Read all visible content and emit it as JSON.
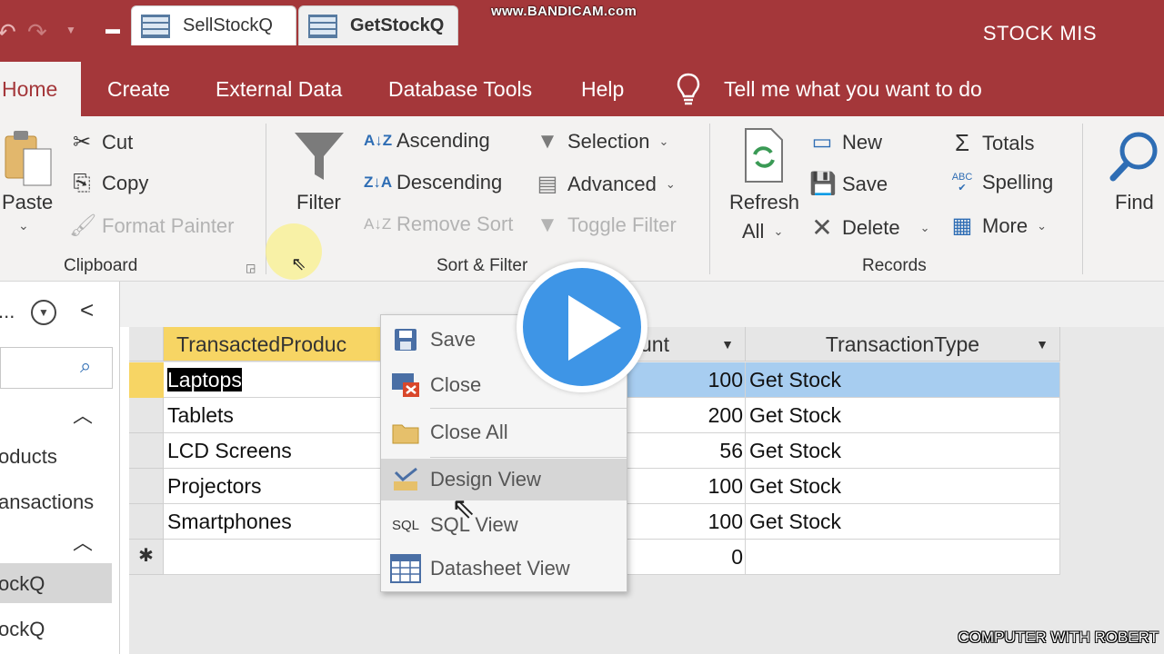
{
  "watermark": "www.BANDICAM.com",
  "app_title": "STOCK MIS",
  "tabs": [
    "Home",
    "Create",
    "External Data",
    "Database Tools",
    "Help"
  ],
  "tell_me": "Tell me what you want to do",
  "clipboard": {
    "paste": "Paste",
    "cut": "Cut",
    "copy": "Copy",
    "format_painter": "Format Painter",
    "label": "Clipboard"
  },
  "sort_filter": {
    "filter": "Filter",
    "ascending": "Ascending",
    "descending": "Descending",
    "remove_sort": "Remove Sort",
    "selection": "Selection",
    "advanced": "Advanced",
    "toggle_filter": "Toggle Filter",
    "label": "Sort & Filter"
  },
  "records": {
    "refresh": "Refresh",
    "refresh_all": "All",
    "new": "New",
    "save": "Save",
    "delete": "Delete",
    "totals": "Totals",
    "spelling": "Spelling",
    "more": "More",
    "label": "Records"
  },
  "find": {
    "label": "Find"
  },
  "nav": {
    "header": "...",
    "items": [
      "oducts",
      "ansactions",
      "ockQ",
      "ockQ"
    ]
  },
  "doc_tabs": [
    "SellStockQ",
    "GetStockQ"
  ],
  "table": {
    "columns": [
      "TransactedProduc",
      "unt",
      "TransactionType"
    ],
    "rows": [
      {
        "product": "Laptops",
        "amount": "100",
        "type": "Get Stock"
      },
      {
        "product": "Tablets",
        "amount": "200",
        "type": "Get Stock"
      },
      {
        "product": "LCD Screens",
        "amount": "56",
        "type": "Get Stock"
      },
      {
        "product": "Projectors",
        "amount": "100",
        "type": "Get Stock"
      },
      {
        "product": "Smartphones",
        "amount": "100",
        "type": "Get Stock"
      }
    ],
    "new_row_amount": "0",
    "new_row_marker": "✱"
  },
  "context_menu": [
    "Save",
    "Close",
    "Close All",
    "Design View",
    "SQL View",
    "Datasheet View"
  ],
  "sql_icon_text": "SQL",
  "abc_text": "ABC",
  "corner_watermark": "COMPUTER WITH ROBERT",
  "colors": {
    "accent": "#a4373a",
    "play": "#3e95e6",
    "selected_row": "#a7cdf0",
    "record_selector": "#f7d564"
  }
}
